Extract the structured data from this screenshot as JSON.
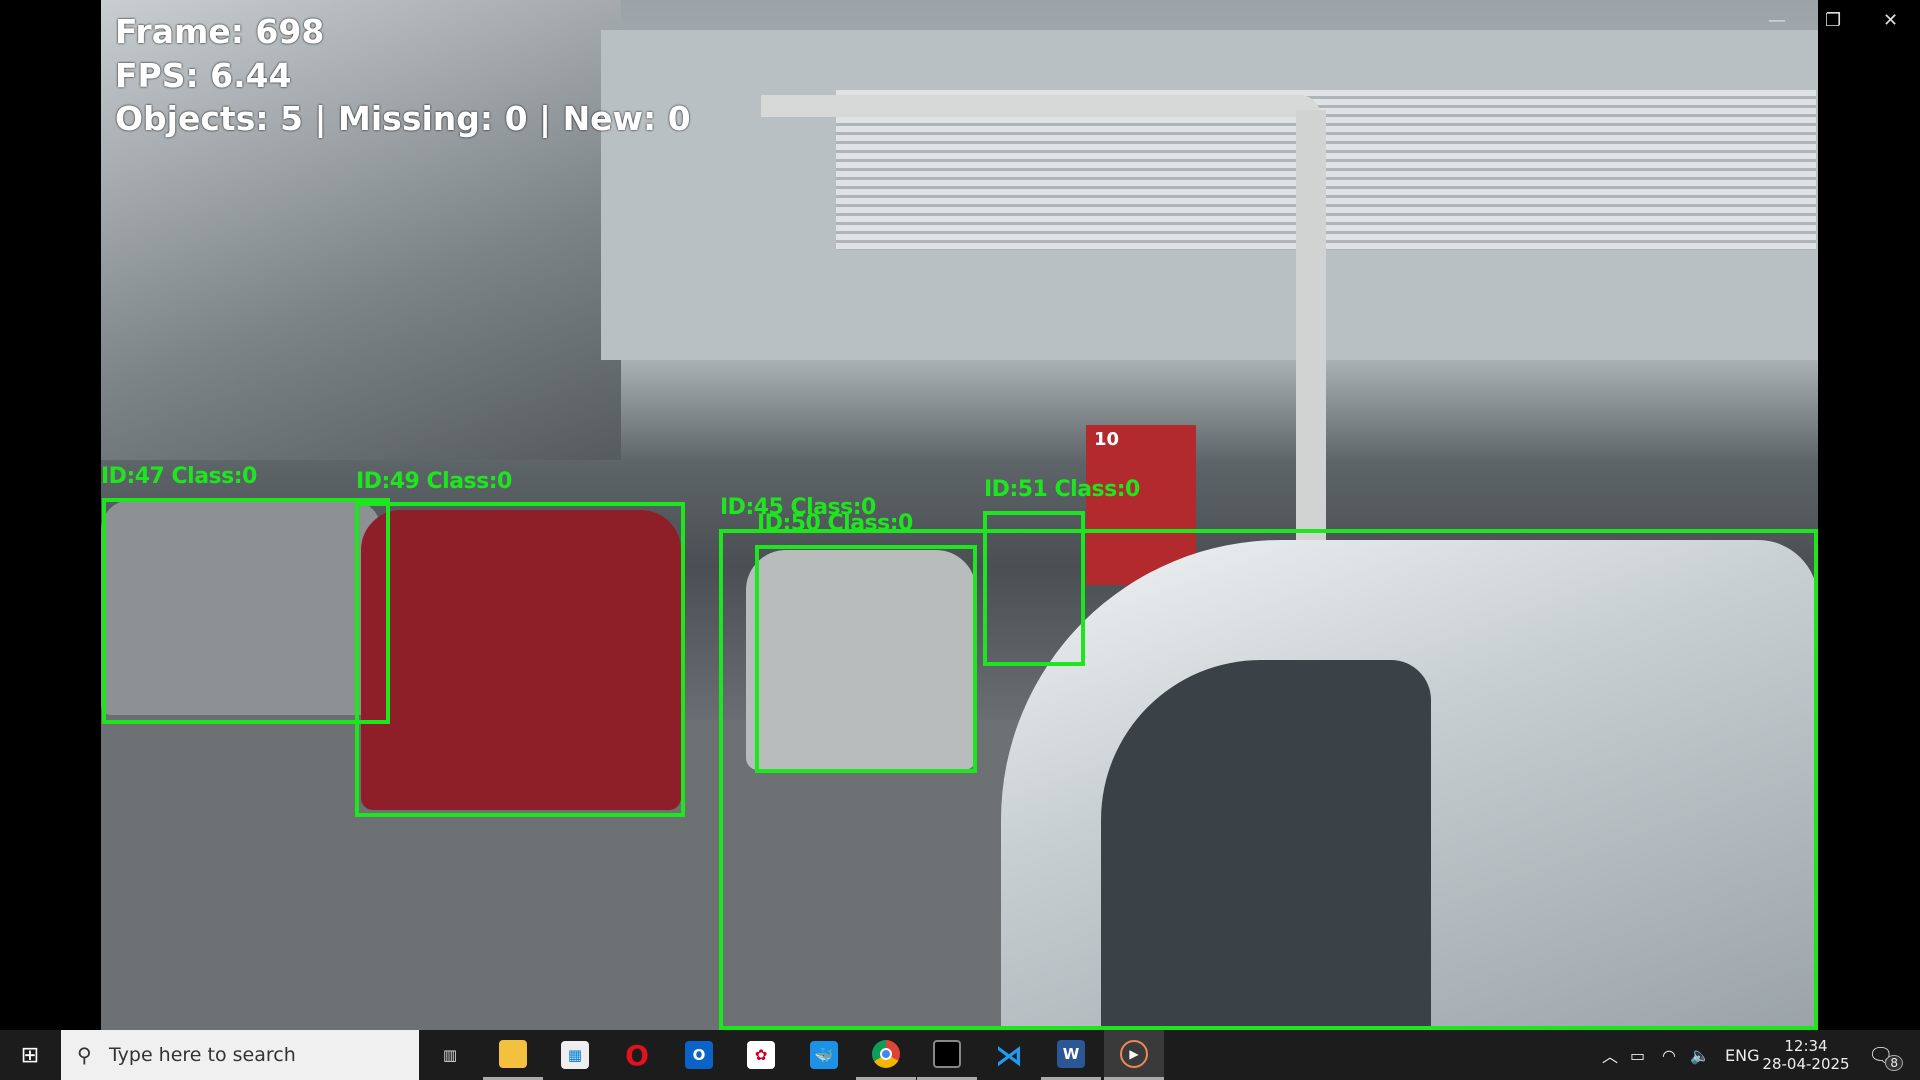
{
  "overlay": {
    "frame": "Frame: 698",
    "fps": "FPS: 6.44",
    "counts": "Objects: 5 | Missing: 0 | New: 0"
  },
  "detections": [
    {
      "label": "ID:47 Class:0"
    },
    {
      "label": "ID:49 Class:0"
    },
    {
      "label": "ID:45 Class:0"
    },
    {
      "label": "ID:50 Class:0"
    },
    {
      "label": "ID:51 Class:0"
    }
  ],
  "scene": {
    "sign_number": "10"
  },
  "box_color": "#1ee61e",
  "taskbar": {
    "search_placeholder": "Type here to search",
    "apps": [
      "Task View",
      "File Explorer",
      "Microsoft Store",
      "Opera",
      "Outlook",
      "App",
      "Docker",
      "Chrome",
      "Terminal",
      "VS Code",
      "Word",
      "Media Player"
    ],
    "language": "ENG",
    "time": "12:34",
    "date": "28-04-2025",
    "notification_count": "8"
  }
}
